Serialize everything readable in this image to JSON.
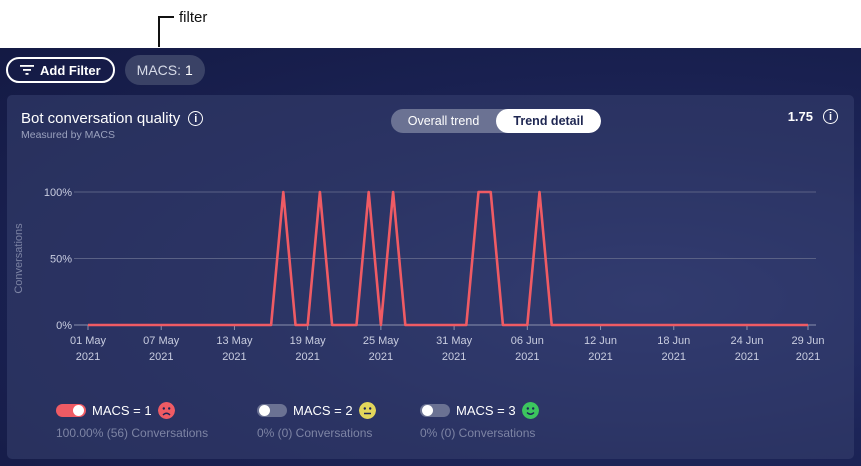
{
  "annotation": {
    "label": "filter"
  },
  "filterbar": {
    "add_filter_label": "Add Filter",
    "chip_key": "MACS:",
    "chip_value": "1"
  },
  "card": {
    "title": "Bot conversation quality",
    "subtitle": "Measured by MACS",
    "tabs": [
      {
        "label": "Overall trend",
        "active": false
      },
      {
        "label": "Trend detail",
        "active": true
      }
    ],
    "score": "1.75"
  },
  "chart_data": {
    "type": "line",
    "ylabel": "Conversations",
    "yticks": [
      "100%",
      "50%",
      "0%"
    ],
    "ylim": [
      0,
      100
    ],
    "xticks": [
      {
        "day": 0,
        "l1": "01 May",
        "l2": "2021"
      },
      {
        "day": 6,
        "l1": "07 May",
        "l2": "2021"
      },
      {
        "day": 12,
        "l1": "13 May",
        "l2": "2021"
      },
      {
        "day": 18,
        "l1": "19 May",
        "l2": "2021"
      },
      {
        "day": 24,
        "l1": "25 May",
        "l2": "2021"
      },
      {
        "day": 30,
        "l1": "31 May",
        "l2": "2021"
      },
      {
        "day": 36,
        "l1": "06 Jun",
        "l2": "2021"
      },
      {
        "day": 42,
        "l1": "12 Jun",
        "l2": "2021"
      },
      {
        "day": 48,
        "l1": "18 Jun",
        "l2": "2021"
      },
      {
        "day": 54,
        "l1": "24 Jun",
        "l2": "2021"
      },
      {
        "day": 59,
        "l1": "29 Jun",
        "l2": "2021"
      }
    ],
    "series": [
      {
        "name": "MACS = 1",
        "color": "#ef5b64",
        "points": [
          [
            0,
            0
          ],
          [
            15,
            0
          ],
          [
            16,
            100
          ],
          [
            17,
            0
          ],
          [
            18,
            0
          ],
          [
            19,
            100
          ],
          [
            20,
            0
          ],
          [
            22,
            0
          ],
          [
            23,
            100
          ],
          [
            24,
            0
          ],
          [
            25,
            100
          ],
          [
            26,
            0
          ],
          [
            31,
            0
          ],
          [
            32,
            100
          ],
          [
            33,
            100
          ],
          [
            34,
            0
          ],
          [
            36,
            0
          ],
          [
            37,
            100
          ],
          [
            38,
            0
          ],
          [
            59,
            0
          ]
        ]
      }
    ]
  },
  "legend": [
    {
      "label": "MACS = 1",
      "sub": "100.00% (56) Conversations",
      "on": true,
      "face": "sad",
      "face_color": "#ef5b64"
    },
    {
      "label": "MACS = 2",
      "sub": "0% (0) Conversations",
      "on": false,
      "face": "neutral",
      "face_color": "#e3d65b"
    },
    {
      "label": "MACS = 3",
      "sub": "0% (0) Conversations",
      "on": false,
      "face": "happy",
      "face_color": "#3cc55e"
    }
  ]
}
